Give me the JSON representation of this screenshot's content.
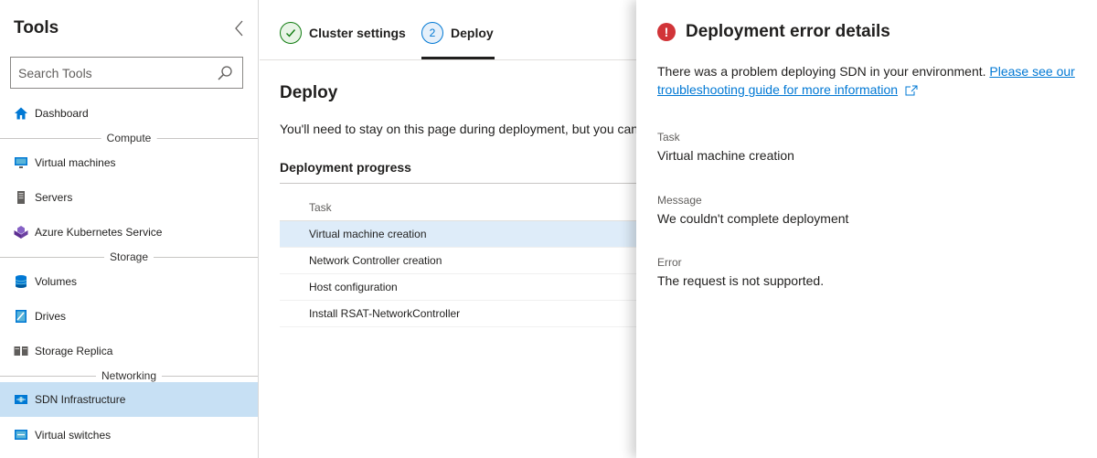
{
  "sidebar": {
    "title": "Tools",
    "search": {
      "placeholder": "Search Tools",
      "value": ""
    },
    "items": {
      "dashboard": "Dashboard",
      "virtual_machines": "Virtual machines",
      "servers": "Servers",
      "aks": "Azure Kubernetes Service",
      "volumes": "Volumes",
      "drives": "Drives",
      "storage_replica": "Storage Replica",
      "sdn_infrastructure": "SDN Infrastructure",
      "virtual_switches": "Virtual switches"
    },
    "sections": {
      "compute": "Compute",
      "storage": "Storage",
      "networking": "Networking"
    },
    "active_item": "SDN Infrastructure"
  },
  "wizard": {
    "steps": [
      {
        "label": "Cluster settings",
        "state": "done"
      },
      {
        "number": "2",
        "label": "Deploy",
        "state": "current"
      }
    ]
  },
  "main": {
    "title": "Deploy",
    "description": "You'll need to stay on this page during deployment, but you can",
    "progress_title": "Deployment progress",
    "table": {
      "header": "Task",
      "rows": [
        "Virtual machine creation",
        "Network Controller creation",
        "Host configuration",
        "Install RSAT-NetworkController"
      ],
      "selected_row": "Virtual machine creation"
    }
  },
  "error_panel": {
    "icon": "!",
    "title": "Deployment error details",
    "message": "There was a problem deploying SDN in your environment. ",
    "link_text": "Please see our troubleshooting guide for more information",
    "task_label": "Task",
    "task_value": "Virtual machine creation",
    "message_label": "Message",
    "message_value": "We couldn't complete deployment",
    "error_label": "Error",
    "error_value": "The request is not supported."
  },
  "colors": {
    "accent": "#0078d4",
    "active_nav": "#c7e0f4",
    "selected_row": "#deecf9",
    "error": "#d13438",
    "success": "#107c10"
  }
}
